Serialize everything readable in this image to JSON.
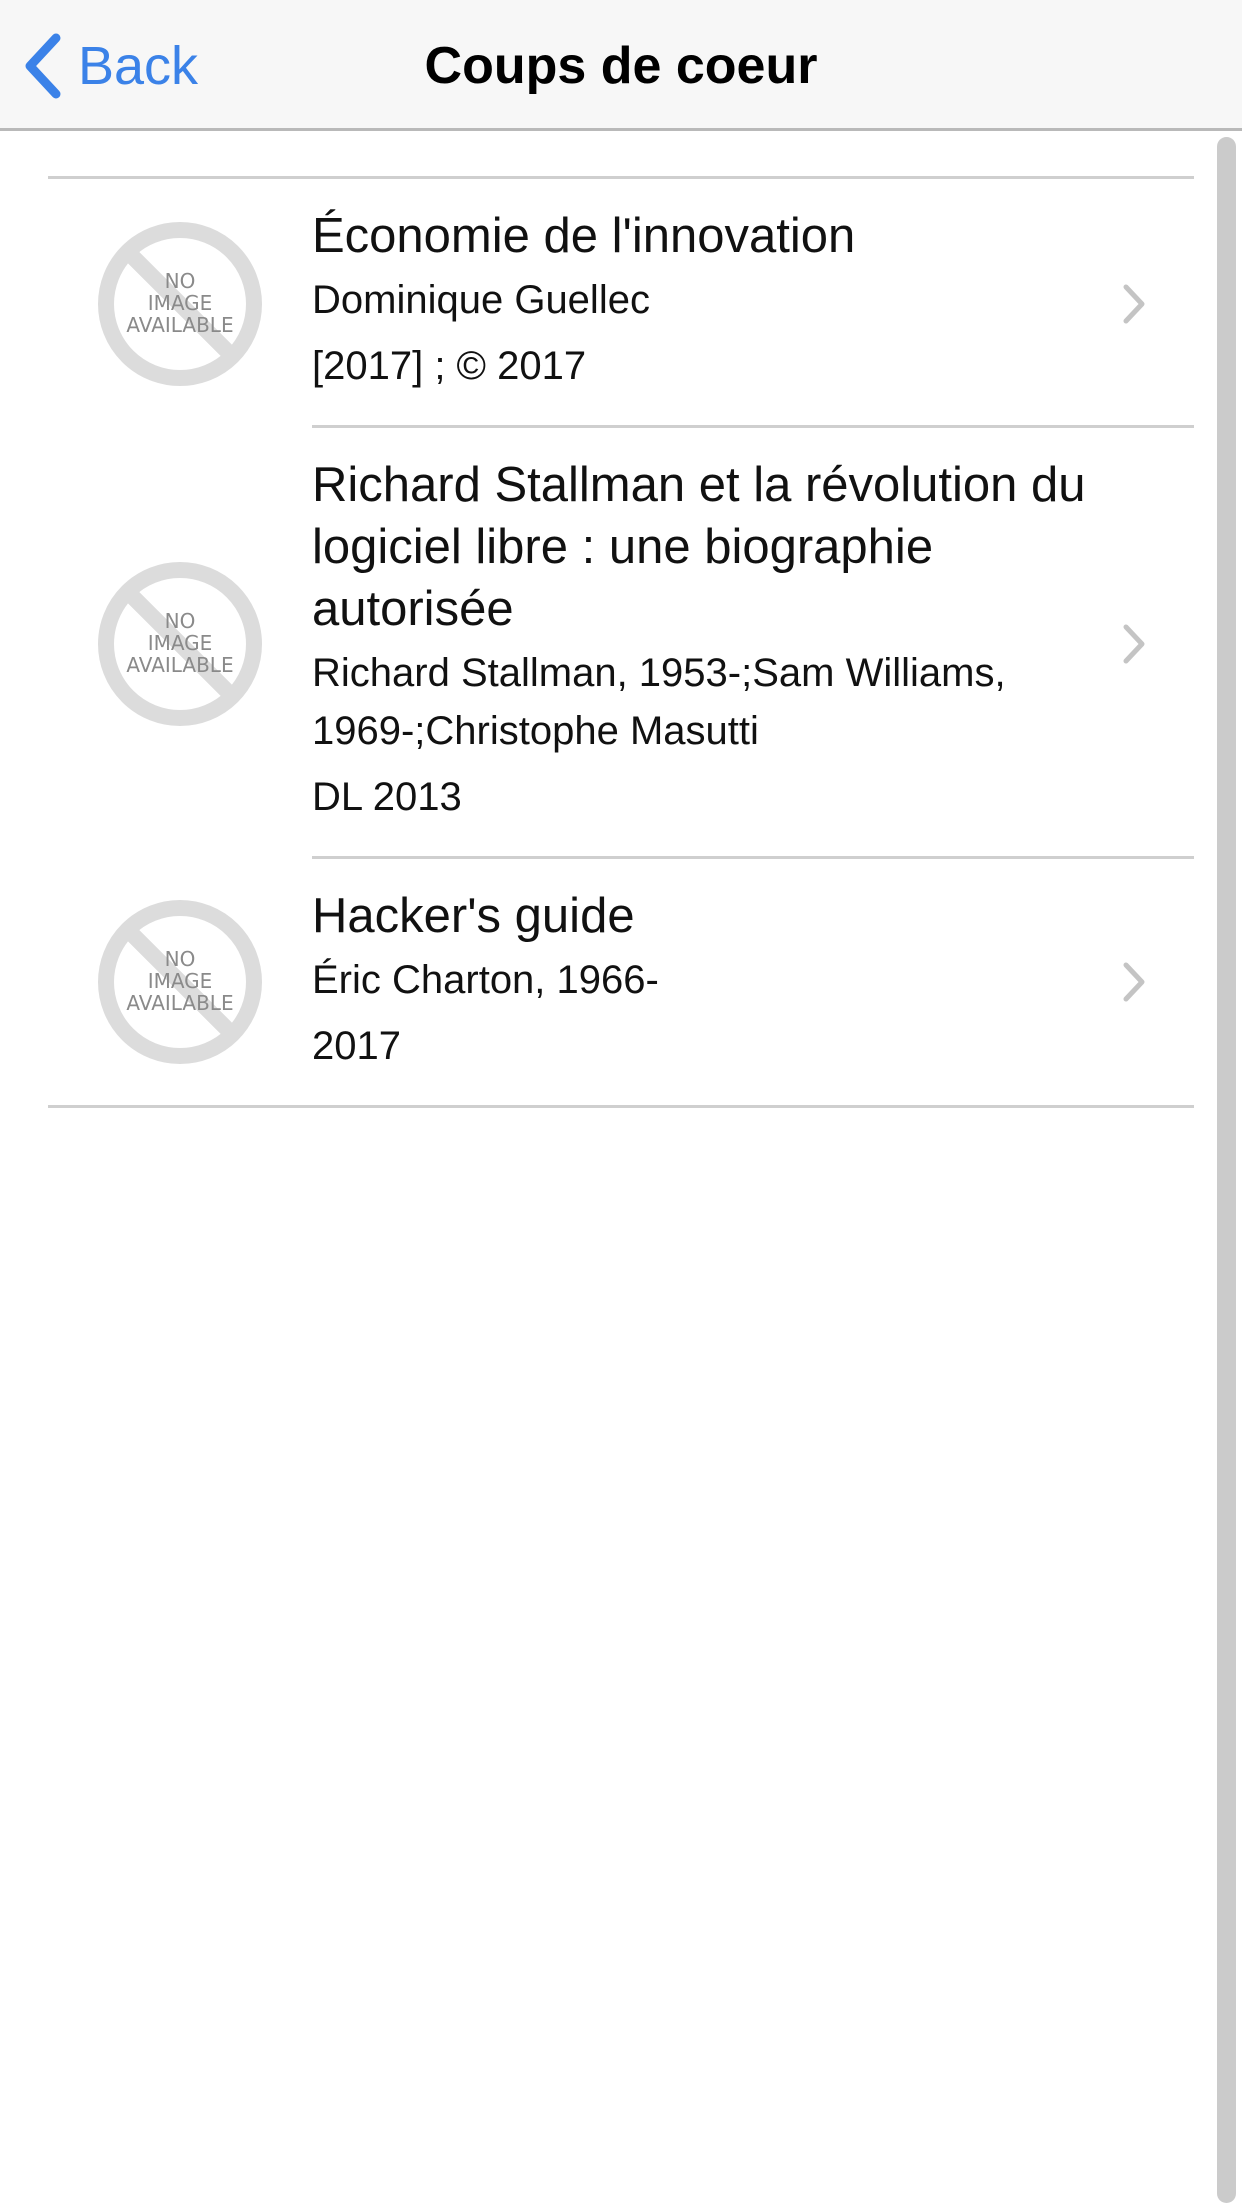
{
  "navbar": {
    "back_label": "Back",
    "title": "Coups de coeur"
  },
  "books": [
    {
      "title": "Économie de l'innovation",
      "authors": "Dominique Guellec",
      "date": "[2017] ; © 2017",
      "thumbnail": "no-image-available"
    },
    {
      "title": "Richard Stallman et la révolution du logiciel libre : une biographie autorisée",
      "authors": "Richard Stallman, 1953-;Sam Williams, 1969-;Christophe Masutti",
      "date": "DL 2013",
      "thumbnail": "no-image-available"
    },
    {
      "title": "Hacker's guide",
      "authors": "Éric Charton, 1966-",
      "date": "2017",
      "thumbnail": "no-image-available"
    }
  ],
  "placeholder": {
    "line1": "NO",
    "line2": "IMAGE",
    "line3": "AVAILABLE"
  },
  "colors": {
    "accent": "#3b82e8",
    "separator": "#cfcfcf",
    "navbar_bg": "#f7f7f7"
  }
}
